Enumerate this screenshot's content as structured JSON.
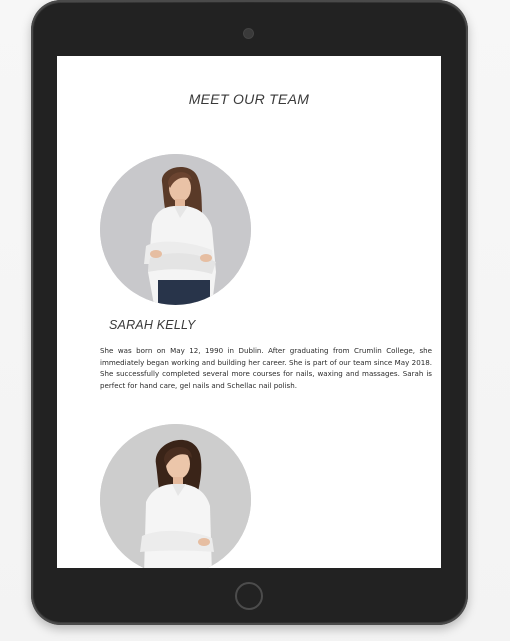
{
  "section": {
    "title": "MEET OUR TEAM"
  },
  "members": [
    {
      "name": "SARAH KELLY",
      "bio": "She was born on May 12, 1990 in Dublin. After graduating from Crumlin College, she immediately began working and building her career. She is part of our team since May 2018. She successfully completed several more courses for nails, waxing and massages. Sarah is perfect for hand care, gel nails and Schellac nail polish.",
      "photo": "woman-arms-crossed-photo"
    },
    {
      "photo": "woman-arms-crossed-photo"
    }
  ],
  "colors": {
    "device_frame": "#2b2b2b",
    "screen_bg": "#ffffff",
    "avatar_bg": "#c8c8cb",
    "text": "#2b2b2b"
  }
}
